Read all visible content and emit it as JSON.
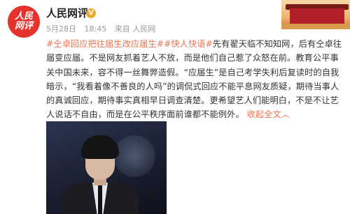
{
  "account": {
    "avatar_text_line1": "人民",
    "avatar_text_line2": "网评",
    "name": "人民网评",
    "verified_icon": "verified-v-badge",
    "post_date": "5月28日",
    "post_time": "18:45",
    "post_source": "来自 人民网"
  },
  "post": {
    "tag1": "#仝卓回应把往届生改应届生#",
    "tag2": "#快人快语#",
    "body": "先有翟天临不知知网，后有仝卓往届变应届。不是网友抓着艺人不放，而是他们自己惹了众怒在前。教育公平事关中国未来，容不得一丝舞弊造假。“应届生”是自己考学失利后复读时的自我暗示，“我看着像不善良的人吗”的调侃式回应不能平息网友质疑，期待当事人的真诚回应，期待事实真相早日调查清楚。更希望艺人们能明白，不是不让艺人说话不自由，而是在公平秩序面前谁都不能例外。",
    "expand_label": "收起全文",
    "expand_icon": "chevron-up-icon"
  },
  "colors": {
    "link": "#eb7350",
    "avatar_bg": "#e5322d",
    "verified": "#f0a830"
  }
}
